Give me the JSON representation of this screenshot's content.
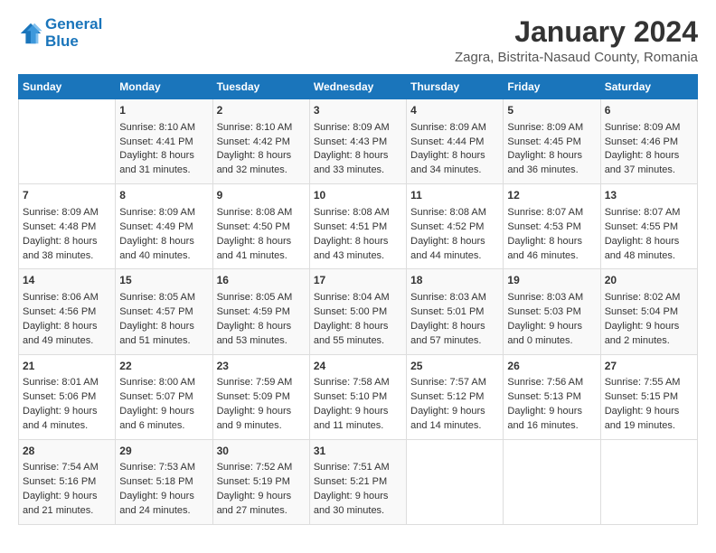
{
  "logo": {
    "line1": "General",
    "line2": "Blue"
  },
  "title": "January 2024",
  "subtitle": "Zagra, Bistrita-Nasaud County, Romania",
  "days_header": [
    "Sunday",
    "Monday",
    "Tuesday",
    "Wednesday",
    "Thursday",
    "Friday",
    "Saturday"
  ],
  "weeks": [
    [
      {
        "day": "",
        "content": ""
      },
      {
        "day": "1",
        "content": "Sunrise: 8:10 AM\nSunset: 4:41 PM\nDaylight: 8 hours\nand 31 minutes."
      },
      {
        "day": "2",
        "content": "Sunrise: 8:10 AM\nSunset: 4:42 PM\nDaylight: 8 hours\nand 32 minutes."
      },
      {
        "day": "3",
        "content": "Sunrise: 8:09 AM\nSunset: 4:43 PM\nDaylight: 8 hours\nand 33 minutes."
      },
      {
        "day": "4",
        "content": "Sunrise: 8:09 AM\nSunset: 4:44 PM\nDaylight: 8 hours\nand 34 minutes."
      },
      {
        "day": "5",
        "content": "Sunrise: 8:09 AM\nSunset: 4:45 PM\nDaylight: 8 hours\nand 36 minutes."
      },
      {
        "day": "6",
        "content": "Sunrise: 8:09 AM\nSunset: 4:46 PM\nDaylight: 8 hours\nand 37 minutes."
      }
    ],
    [
      {
        "day": "7",
        "content": "Sunrise: 8:09 AM\nSunset: 4:48 PM\nDaylight: 8 hours\nand 38 minutes."
      },
      {
        "day": "8",
        "content": "Sunrise: 8:09 AM\nSunset: 4:49 PM\nDaylight: 8 hours\nand 40 minutes."
      },
      {
        "day": "9",
        "content": "Sunrise: 8:08 AM\nSunset: 4:50 PM\nDaylight: 8 hours\nand 41 minutes."
      },
      {
        "day": "10",
        "content": "Sunrise: 8:08 AM\nSunset: 4:51 PM\nDaylight: 8 hours\nand 43 minutes."
      },
      {
        "day": "11",
        "content": "Sunrise: 8:08 AM\nSunset: 4:52 PM\nDaylight: 8 hours\nand 44 minutes."
      },
      {
        "day": "12",
        "content": "Sunrise: 8:07 AM\nSunset: 4:53 PM\nDaylight: 8 hours\nand 46 minutes."
      },
      {
        "day": "13",
        "content": "Sunrise: 8:07 AM\nSunset: 4:55 PM\nDaylight: 8 hours\nand 48 minutes."
      }
    ],
    [
      {
        "day": "14",
        "content": "Sunrise: 8:06 AM\nSunset: 4:56 PM\nDaylight: 8 hours\nand 49 minutes."
      },
      {
        "day": "15",
        "content": "Sunrise: 8:05 AM\nSunset: 4:57 PM\nDaylight: 8 hours\nand 51 minutes."
      },
      {
        "day": "16",
        "content": "Sunrise: 8:05 AM\nSunset: 4:59 PM\nDaylight: 8 hours\nand 53 minutes."
      },
      {
        "day": "17",
        "content": "Sunrise: 8:04 AM\nSunset: 5:00 PM\nDaylight: 8 hours\nand 55 minutes."
      },
      {
        "day": "18",
        "content": "Sunrise: 8:03 AM\nSunset: 5:01 PM\nDaylight: 8 hours\nand 57 minutes."
      },
      {
        "day": "19",
        "content": "Sunrise: 8:03 AM\nSunset: 5:03 PM\nDaylight: 9 hours\nand 0 minutes."
      },
      {
        "day": "20",
        "content": "Sunrise: 8:02 AM\nSunset: 5:04 PM\nDaylight: 9 hours\nand 2 minutes."
      }
    ],
    [
      {
        "day": "21",
        "content": "Sunrise: 8:01 AM\nSunset: 5:06 PM\nDaylight: 9 hours\nand 4 minutes."
      },
      {
        "day": "22",
        "content": "Sunrise: 8:00 AM\nSunset: 5:07 PM\nDaylight: 9 hours\nand 6 minutes."
      },
      {
        "day": "23",
        "content": "Sunrise: 7:59 AM\nSunset: 5:09 PM\nDaylight: 9 hours\nand 9 minutes."
      },
      {
        "day": "24",
        "content": "Sunrise: 7:58 AM\nSunset: 5:10 PM\nDaylight: 9 hours\nand 11 minutes."
      },
      {
        "day": "25",
        "content": "Sunrise: 7:57 AM\nSunset: 5:12 PM\nDaylight: 9 hours\nand 14 minutes."
      },
      {
        "day": "26",
        "content": "Sunrise: 7:56 AM\nSunset: 5:13 PM\nDaylight: 9 hours\nand 16 minutes."
      },
      {
        "day": "27",
        "content": "Sunrise: 7:55 AM\nSunset: 5:15 PM\nDaylight: 9 hours\nand 19 minutes."
      }
    ],
    [
      {
        "day": "28",
        "content": "Sunrise: 7:54 AM\nSunset: 5:16 PM\nDaylight: 9 hours\nand 21 minutes."
      },
      {
        "day": "29",
        "content": "Sunrise: 7:53 AM\nSunset: 5:18 PM\nDaylight: 9 hours\nand 24 minutes."
      },
      {
        "day": "30",
        "content": "Sunrise: 7:52 AM\nSunset: 5:19 PM\nDaylight: 9 hours\nand 27 minutes."
      },
      {
        "day": "31",
        "content": "Sunrise: 7:51 AM\nSunset: 5:21 PM\nDaylight: 9 hours\nand 30 minutes."
      },
      {
        "day": "",
        "content": ""
      },
      {
        "day": "",
        "content": ""
      },
      {
        "day": "",
        "content": ""
      }
    ]
  ]
}
